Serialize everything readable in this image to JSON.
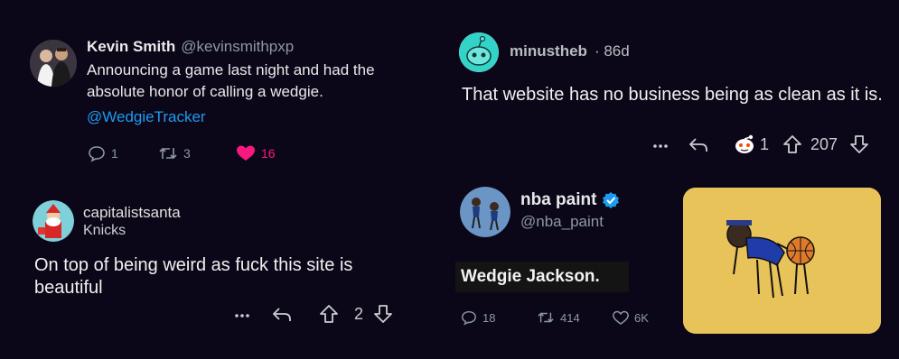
{
  "tweet1": {
    "name": "Kevin Smith",
    "handle": "@kevinsmithpxp",
    "text": "Announcing a game last night and had the absolute honor of calling a wedgie.",
    "mention": "@WedgieTracker",
    "replies": "1",
    "retweets": "3",
    "likes": "16",
    "like_color": "#f91880"
  },
  "reddit1": {
    "username": "minustheb",
    "age": "· 86d",
    "text": "That website has no business being as clean as it is.",
    "award_count": "1",
    "votes": "207"
  },
  "reddit2": {
    "username": "capitalistsanta",
    "flair": "Knicks",
    "text": "On top of being weird as fuck this site is beautiful",
    "votes": "2"
  },
  "tweet2": {
    "name": "nba paint",
    "handle": "@nba_paint",
    "caption": "Wedgie Jackson.",
    "replies": "18",
    "retweets": "414",
    "likes": "6K",
    "verified_color": "#1d9bf0",
    "image_bg": "#e8c35a"
  }
}
